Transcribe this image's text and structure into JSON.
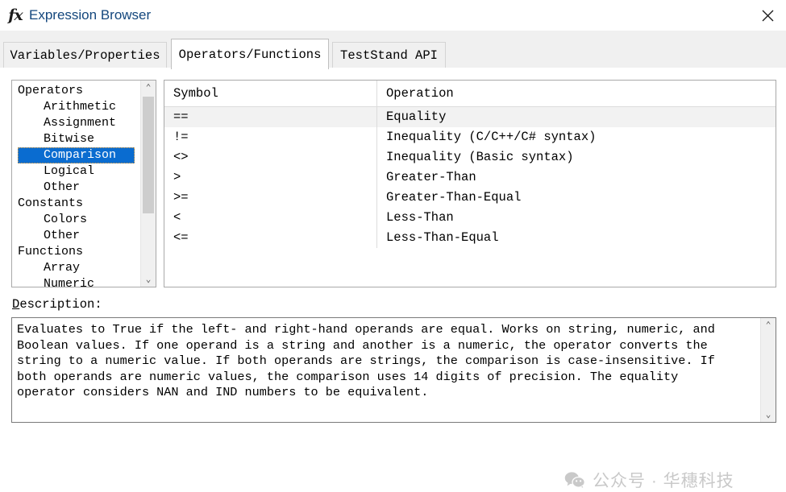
{
  "window": {
    "icon": "fx-icon",
    "title": "Expression Browser",
    "close_label": "✕"
  },
  "tabs": [
    {
      "label": "Variables/Properties",
      "active": false
    },
    {
      "label": "Operators/Functions",
      "active": true
    },
    {
      "label": "TestStand API",
      "active": false
    }
  ],
  "tree": {
    "items": [
      {
        "label": "Operators",
        "level": 0,
        "selected": false
      },
      {
        "label": "Arithmetic",
        "level": 1,
        "selected": false
      },
      {
        "label": "Assignment",
        "level": 1,
        "selected": false
      },
      {
        "label": "Bitwise",
        "level": 1,
        "selected": false
      },
      {
        "label": "Comparison",
        "level": 1,
        "selected": true
      },
      {
        "label": "Logical",
        "level": 1,
        "selected": false
      },
      {
        "label": "Other",
        "level": 1,
        "selected": false
      },
      {
        "label": "Constants",
        "level": 0,
        "selected": false
      },
      {
        "label": "Colors",
        "level": 1,
        "selected": false
      },
      {
        "label": "Other",
        "level": 1,
        "selected": false
      },
      {
        "label": "Functions",
        "level": 0,
        "selected": false
      },
      {
        "label": "Array",
        "level": 1,
        "selected": false
      },
      {
        "label": "Numeric",
        "level": 1,
        "selected": false
      }
    ],
    "scrollbar": {
      "up_arrow": "⌃",
      "down_arrow": "⌄"
    }
  },
  "table": {
    "columns": [
      "Symbol",
      "Operation"
    ],
    "rows": [
      {
        "symbol": "==",
        "operation": "Equality",
        "selected": true
      },
      {
        "symbol": "!=",
        "operation": "Inequality (C/C++/C# syntax)",
        "selected": false
      },
      {
        "symbol": "<>",
        "operation": "Inequality (Basic syntax)",
        "selected": false
      },
      {
        "symbol": ">",
        "operation": "Greater-Than",
        "selected": false
      },
      {
        "symbol": ">=",
        "operation": "Greater-Than-Equal",
        "selected": false
      },
      {
        "symbol": "<",
        "operation": "Less-Than",
        "selected": false
      },
      {
        "symbol": "<=",
        "operation": "Less-Than-Equal",
        "selected": false
      }
    ]
  },
  "description": {
    "label_first_letter": "D",
    "label_rest": "escription:",
    "text": "Evaluates to True if the left- and right-hand operands are equal. Works on string, numeric, and\nBoolean values. If one operand is a string and another is a numeric, the operator converts the\nstring to a numeric value. If both operands are strings, the comparison is case-insensitive. If\nboth operands are numeric values, the comparison uses 14 digits of precision. The equality\noperator considers NAN and IND numbers to be equivalent.",
    "scrollbar": {
      "up_arrow": "⌃",
      "down_arrow": "⌄"
    }
  },
  "watermark": {
    "icon": "wechat-icon",
    "text": "公众号 · 华穗科技"
  },
  "colors": {
    "title_text": "#14477d",
    "selection_blue": "#0a6cd0",
    "row_selected": "#f2f2f2",
    "tab_inactive": "#f0f0f0",
    "border": "#a9a9a9"
  }
}
